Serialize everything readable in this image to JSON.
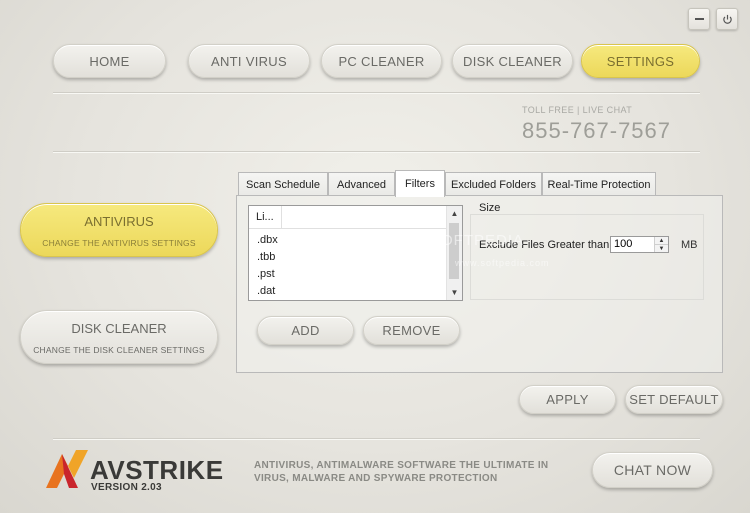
{
  "window": {
    "minimize_icon": "minimize-icon",
    "power_icon": "power-icon"
  },
  "nav": {
    "items": [
      {
        "label": "HOME",
        "active": false
      },
      {
        "label": "ANTI VIRUS",
        "active": false
      },
      {
        "label": "PC CLEANER",
        "active": false
      },
      {
        "label": "DISK CLEANER",
        "active": false
      },
      {
        "label": "SETTINGS",
        "active": true
      }
    ]
  },
  "contact": {
    "caption": "TOLL FREE | LIVE CHAT",
    "phone": "855-767-7567"
  },
  "sidebar": {
    "items": [
      {
        "title": "ANTIVIRUS",
        "subtitle": "CHANGE THE ANTIVIRUS SETTINGS",
        "active": true
      },
      {
        "title": "DISK CLEANER",
        "subtitle": "CHANGE THE DISK CLEANER SETTINGS",
        "active": false
      }
    ]
  },
  "tabs": [
    {
      "label": "Scan Schedule",
      "active": false
    },
    {
      "label": "Advanced",
      "active": false
    },
    {
      "label": "Filters",
      "active": true
    },
    {
      "label": "Excluded Folders",
      "active": false
    },
    {
      "label": "Real-Time Protection",
      "active": false
    }
  ],
  "filters": {
    "list_header": "Li...",
    "list_items": [
      ".dbx",
      ".tbb",
      ".pst",
      ".dat"
    ],
    "add_label": "ADD",
    "remove_label": "REMOVE",
    "size_group_label": "Size",
    "exclude_label": "Exclude Files Greater than:",
    "exclude_value": "100",
    "unit_label": "MB"
  },
  "actions": {
    "apply_label": "APPLY",
    "set_default_label": "SET DEFAULT"
  },
  "footer": {
    "brand": "AVSTRIKE",
    "version": "VERSION 2.03",
    "tagline": "ANTIVIRUS, ANTIMALWARE SOFTWARE THE ULTIMATE IN VIRUS, MALWARE AND SPYWARE PROTECTION",
    "chat_label": "CHAT NOW"
  },
  "watermark": {
    "text1": "SOFTPEDIA",
    "text2": "www.softpedia.com"
  },
  "colors": {
    "accent_yellow": "#ecd85a",
    "logo_orange": "#e8731f",
    "logo_red": "#c9252c"
  }
}
